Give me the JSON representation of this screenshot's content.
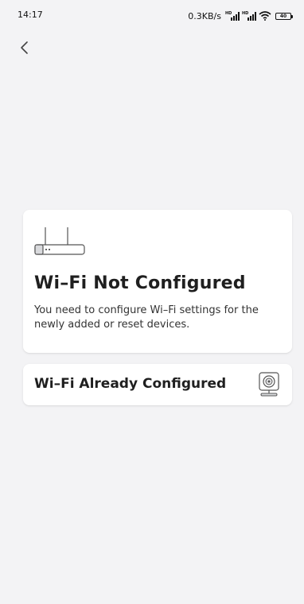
{
  "status_bar": {
    "time": "14:17",
    "network_speed": "0.3KB/s",
    "signal_1_label": "HD",
    "signal_2_label": "HD",
    "battery_level": "40"
  },
  "nav": {
    "back_icon": "chevron-left-icon"
  },
  "options": [
    {
      "icon": "router-icon",
      "title": "Wi–Fi Not Configured",
      "description": "You need to configure Wi–Fi settings for the newly added or reset devices."
    },
    {
      "icon": "camera-icon",
      "title": "Wi–Fi Already Configured"
    }
  ],
  "colors": {
    "background": "#f3f3f5",
    "card": "#ffffff",
    "text": "#1f1f1f"
  }
}
